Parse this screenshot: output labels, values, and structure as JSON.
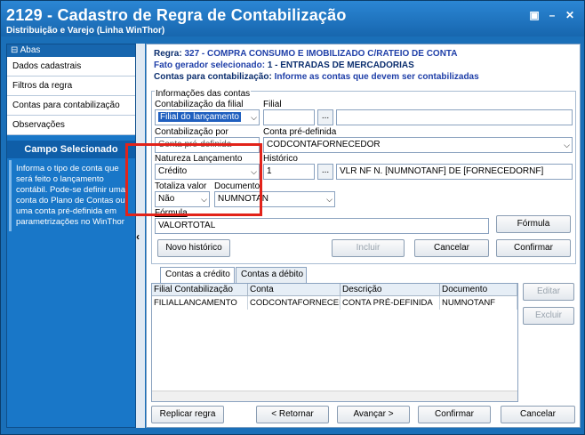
{
  "window": {
    "title": "2129 - Cadastro de Regra de Contabilização",
    "subtitle": "Distribuição e Varejo (Linha WinThor)",
    "btn_restore": "▣",
    "btn_min": "–",
    "btn_close": "✕"
  },
  "sidebar": {
    "header": "⊟ Abas",
    "items": [
      {
        "label": "Dados cadastrais"
      },
      {
        "label": "Filtros da regra"
      },
      {
        "label": "Contas para contabilização"
      },
      {
        "label": "Observações"
      }
    ],
    "section_title": "Campo Selecionado",
    "help_text": "Informa o tipo de conta que será feito o lançamento contábil. Pode-se definir uma conta do Plano de Contas ou uma conta pré-definida em parametrizações no WinThor",
    "collapse_glyph": "‹"
  },
  "header": {
    "regra_label": "Regra:",
    "regra_value": "327 - COMPRA CONSUMO E IMOBILIZADO C/RATEIO DE CONTA",
    "fato_label": "Fato gerador selecionado:",
    "fato_value": "1 - ENTRADAS DE MERCADORIAS",
    "contas_label": "Contas para contabilização:",
    "contas_value": "Informe as contas que devem ser contabilizadas"
  },
  "form": {
    "group_label": "Informações das contas",
    "contab_filial_label": "Contabilização da filial",
    "contab_filial_value": "Filial do lançamento",
    "filial_label": "Filial",
    "filial_value": "",
    "filial_desc": "",
    "contab_por_label": "Contabilização por",
    "contab_por_value": "Conta pré-definida",
    "conta_pre_label": "Conta pré-definida",
    "conta_pre_value": "CODCONTAFORNECEDOR",
    "natureza_label": "Natureza Lançamento",
    "natureza_value": "Crédito",
    "historico_label": "Histórico",
    "historico_code": "1",
    "historico_text": "VLR NF N. [NUMNOTANF] DE [FORNECEDORNF]",
    "totaliza_label": "Totaliza valor",
    "totaliza_value": "Não",
    "documento_label": "Documento",
    "documento_value": "NUMNOTAN",
    "formula_label": "Fórmula",
    "formula_value": "VALORTOTAL",
    "formula_btn": "Fórmula",
    "novo_hist_btn": "Novo histórico",
    "incluir_btn": "Incluir",
    "cancelar_btn": "Cancelar",
    "confirmar_btn": "Confirmar",
    "ellipsis": "..."
  },
  "tabs": [
    {
      "label": "Contas a crédito"
    },
    {
      "label": "Contas a débito"
    }
  ],
  "table": {
    "columns": [
      "Filial Contabilização",
      "Conta",
      "Descrição",
      "Documento"
    ],
    "rows": [
      [
        "FILIALLANCAMENTO",
        "CODCONTAFORNECEDOR",
        "CONTA PRÉ-DEFINIDA",
        "NUMNOTANF"
      ]
    ]
  },
  "side_buttons": {
    "editar": "Editar",
    "excluir": "Excluir"
  },
  "footer": {
    "replicar": "Replicar regra",
    "retornar": "< Retornar",
    "avancar": "Avançar >",
    "confirmar": "Confirmar",
    "cancelar": "Cancelar"
  },
  "colors": {
    "title_bar": "#1766ae",
    "sidebar": "#1977c8",
    "highlight": "#e2231a",
    "selection": "#1f5fbf"
  }
}
